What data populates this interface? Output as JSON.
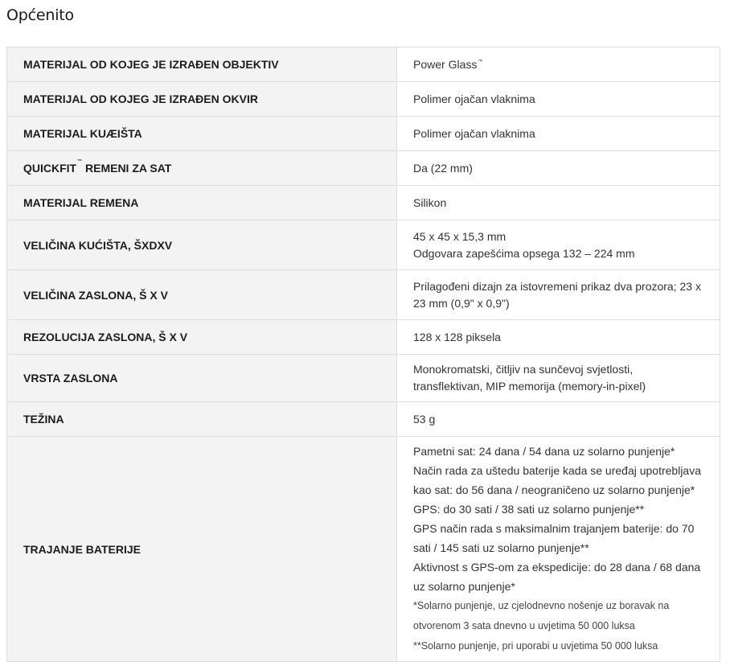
{
  "section": {
    "title": "Općenito"
  },
  "tm_symbol": "™",
  "rows": [
    {
      "label": "MATERIJAL OD KOJEG JE IZRAĐEN OBJEKTIV",
      "value": [
        "Power Glass"
      ]
    },
    {
      "label": "MATERIJAL OD KOJEG JE IZRAĐEN OKVIR",
      "value": [
        "Polimer ojačan vlaknima"
      ]
    },
    {
      "label": "MATERIJAL KUÆIŠTA",
      "value": [
        "Polimer ojačan vlaknima"
      ]
    },
    {
      "label_pre": "QUICKFIT",
      "label_post": " REMENI ZA SAT",
      "value": [
        "Da (22 mm)"
      ]
    },
    {
      "label": "MATERIJAL REMENA",
      "value": [
        "Silikon"
      ]
    },
    {
      "label": "VELIČINA KUĆIŠTA, ŠXDXV",
      "value": [
        "45 x 45 x 15,3 mm",
        "Odgovara zapešćima opsega 132 – 224 mm"
      ]
    },
    {
      "label": "VELIČINA ZASLONA, Š X V",
      "value": [
        "Prilagođeni dizajn za istovremeni prikaz dva prozora; 23 x 23 mm (0,9\" x 0,9\")"
      ]
    },
    {
      "label": "REZOLUCIJA ZASLONA, Š X V",
      "value": [
        "128 x 128 piksela"
      ]
    },
    {
      "label": "VRSTA ZASLONA",
      "value": [
        "Monokromatski, čitljiv na sunčevoj svjetlosti, transflektivan, MIP memorija (memory-in-pixel)"
      ]
    },
    {
      "label": "TEŽINA",
      "value": [
        "53 g"
      ]
    },
    {
      "label": "TRAJANJE BATERIJE",
      "value": [
        "Pametni sat: 24 dana / 54 dana uz solarno punjenje*",
        "Način rada za uštedu baterije kada se uređaj upotrebljava kao sat: do 56 dana / neograničeno uz solarno punjenje*",
        "GPS: do 30 sati / 38 sati uz solarno punjenje**",
        "GPS način rada s maksimalnim trajanjem baterije: do 70 sati / 145 sati uz solarno punjenje**",
        "Aktivnost s GPS-om za ekspedicije: do 28 dana / 68 dana uz solarno punjenje*"
      ],
      "notes": [
        "*Solarno punjenje, uz cjelodnevno nošenje uz boravak na otvorenom 3 sata dnevno u uvjetima 50 000 luksa",
        "**Solarno punjenje, pri uporabi u uvjetima 50 000 luksa"
      ]
    }
  ]
}
